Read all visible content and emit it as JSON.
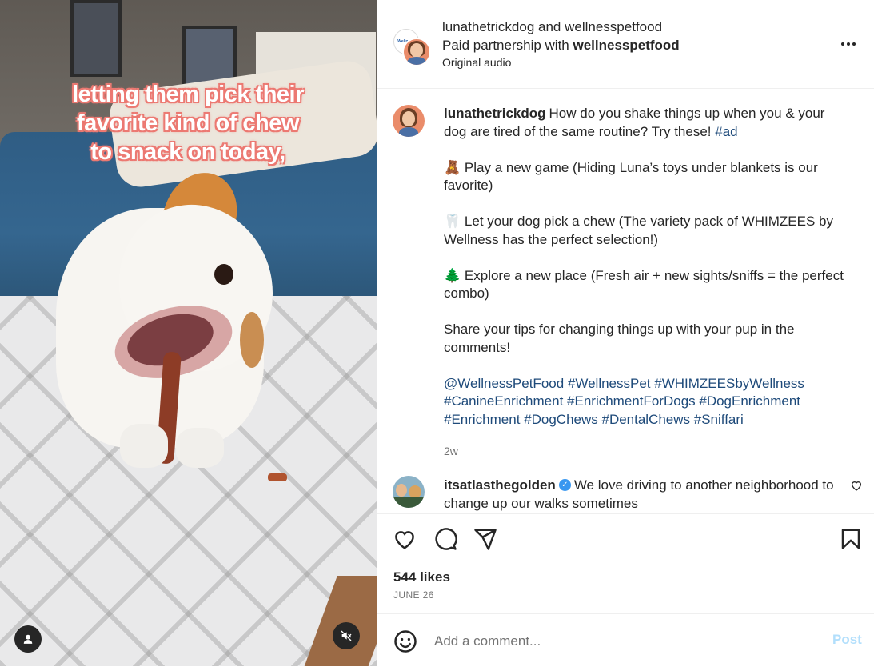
{
  "media": {
    "caption_lines": [
      "letting them pick their",
      "favorite kind of chew",
      "to snack on today,"
    ],
    "tag_icon": "person-tag-icon",
    "mute_icon": "speaker-muted-icon"
  },
  "header": {
    "users_line": "lunathetrickdog and wellnesspetfood",
    "paid_prefix": "Paid partnership with ",
    "paid_partner": "wellnesspetfood",
    "audio": "Original audio",
    "brand_avatar_text": "Wellness"
  },
  "post": {
    "username": "lunathetrickdog",
    "intro": "How do you shake things up when you & your dog are tired of the same routine? Try these! ",
    "intro_tag": "#ad",
    "items": [
      {
        "emoji": "🧸",
        "text": "Play a new game (Hiding Luna’s toys under blankets is our favorite)"
      },
      {
        "emoji": "🦷",
        "text": "Let your dog pick a chew (The variety pack of WHIMZEES by Wellness has the perfect selection!)"
      },
      {
        "emoji": "🌲",
        "text": "Explore a new place (Fresh air + new sights/sniffs = the perfect combo)"
      }
    ],
    "closing": "Share your tips for changing things up with your pup in the comments!",
    "hashtags": "@WellnessPetFood #WellnessPet #WHIMZEESbyWellness #CanineEnrichment #EnrichmentForDogs #DogEnrichment #Enrichment #DogChews #DentalChews #Sniffari",
    "age": "2w"
  },
  "comment": {
    "username": "itsatlasthegolden",
    "verified_mark": "✓",
    "text": "We love driving to another neighborhood to change up our walks sometimes"
  },
  "actions": {
    "likes": "544 likes",
    "date": "JUNE 26"
  },
  "compose": {
    "placeholder": "Add a comment...",
    "post_label": "Post"
  },
  "colors": {
    "link": "#1e4a7a",
    "verified": "#3897f0",
    "post_button_disabled": "#b2dffc",
    "caption_outline": "#ec7a73"
  }
}
